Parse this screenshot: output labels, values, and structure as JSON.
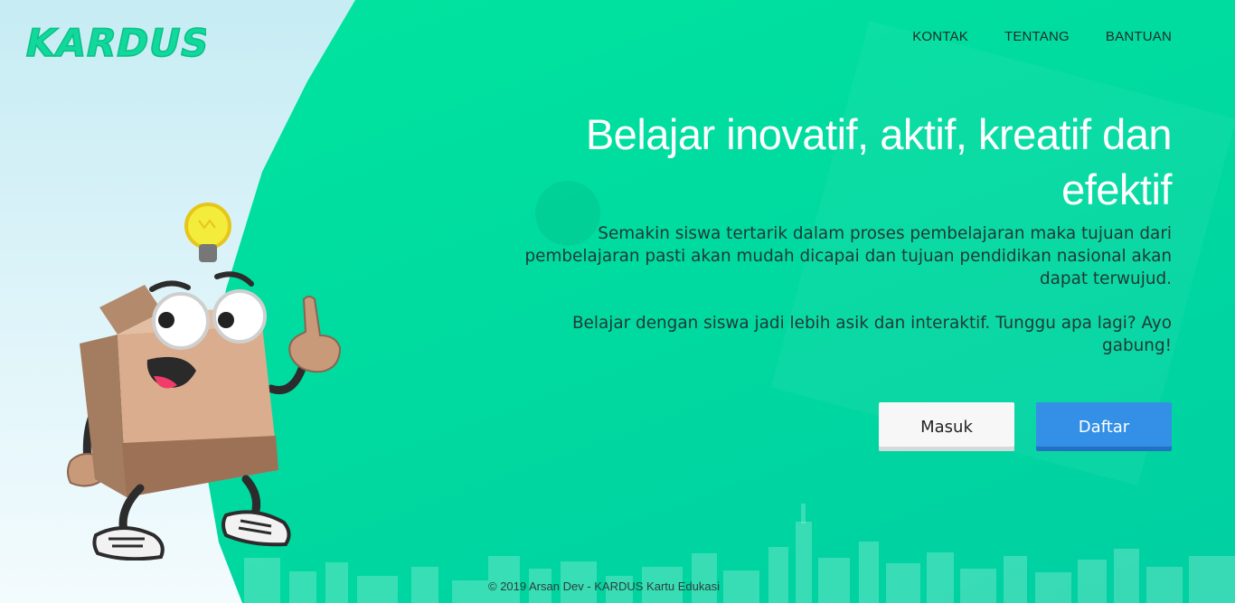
{
  "brand": {
    "logo_text": "KARDUS!"
  },
  "nav": {
    "items": [
      "KONTAK",
      "TENTANG",
      "BANTUAN"
    ]
  },
  "hero": {
    "title_line1": "Belajar inovatif, aktif, kreatif dan",
    "title_line2": "efektif",
    "paragraph1": "Semakin siswa tertarik dalam proses pembelajaran maka tujuan dari pembelajaran pasti akan mudah dicapai dan tujuan pendidikan nasional akan dapat terwujud.",
    "paragraph2": "Belajar dengan siswa jadi lebih asik dan interaktif. Tunggu apa lagi? Ayo gabung!"
  },
  "buttons": {
    "login": "Masuk",
    "register": "Daftar"
  },
  "footer": {
    "text": "© 2019 Arsan Dev - KARDUS Kartu Edukasi"
  },
  "colors": {
    "primary_green": "#00e1a0",
    "button_blue": "#3390e6",
    "left_bg": "#c7ecf4"
  },
  "icons": [
    "kardus-logo",
    "box-mascot-illustration",
    "lightbulb-icon",
    "city-skyline-illustration"
  ]
}
